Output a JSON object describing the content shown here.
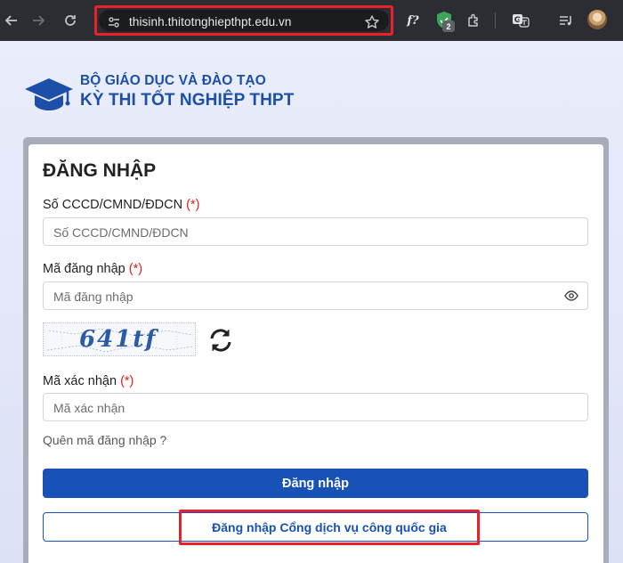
{
  "browser": {
    "url": "thisinh.thitotnghiepthpt.edu.vn",
    "extension_badge": "2",
    "icons": [
      "back-icon",
      "forward-icon",
      "reload-icon",
      "site-info-icon",
      "star-icon",
      "function-extension-icon",
      "shield-extension-icon",
      "puzzle-extensions-icon",
      "translate-icon",
      "media-queue-icon",
      "profile-avatar"
    ]
  },
  "brand": {
    "line1": "BỘ GIÁO DỤC VÀ ĐÀO TẠO",
    "line2": "KỲ THI TỐT NGHIỆP THPT",
    "color": "#1b4fa8"
  },
  "form": {
    "title": "ĐĂNG NHẬP",
    "required_mark": "(*)",
    "id_label": "Số CCCD/CMND/ĐDCN",
    "id_placeholder": "Số CCCD/CMND/ĐDCN",
    "login_code_label": "Mã đăng nhập",
    "login_code_placeholder": "Mã đăng nhập",
    "captcha_text": "641tf",
    "captcha_label": "Mã xác nhận",
    "captcha_placeholder": "Mã xác nhận",
    "forgot_link": "Quên mã đăng nhập ?",
    "login_button": "Đăng nhập",
    "national_portal_button": "Đăng nhập Cổng dịch vụ công quốc gia"
  },
  "colors": {
    "primary": "#1852b6",
    "required": "#e02020",
    "highlight": "#e8212b"
  }
}
